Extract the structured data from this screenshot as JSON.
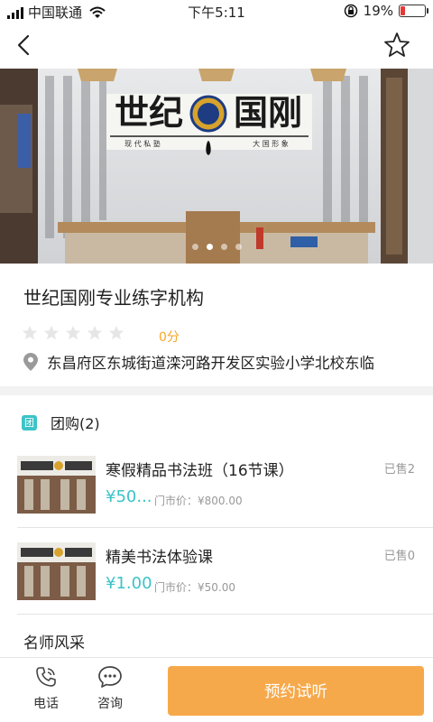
{
  "status_bar": {
    "carrier": "中国联通",
    "time": "下午5:11",
    "battery_percent": "19%",
    "battery_level": 0.19,
    "icons": [
      "signal-icon",
      "wifi-icon",
      "orientation-lock-icon",
      "battery-icon"
    ]
  },
  "nav": {
    "back_icon": "back-arrow-icon",
    "favorite_icon": "star-outline-icon"
  },
  "banner": {
    "sign_left": "世纪",
    "sign_right": "国刚",
    "sign_sub_left": "现 代 私 塾",
    "sign_sub_right": "大 国 形 象",
    "slide_count": 4,
    "active_slide": 2
  },
  "shop": {
    "name": "世纪国刚专业练字机构",
    "stars_filled": 0,
    "stars_total": 5,
    "rating": "0分",
    "address": "东昌府区东城街道滦河路开发区实验小学北校东临"
  },
  "deals": {
    "badge": "团",
    "title": "团购(2)",
    "items": [
      {
        "title": "寒假精品书法班（16节课）",
        "price": "¥50...",
        "orig_label": "门市价：",
        "orig_price": "¥800.00",
        "sold": "已售2"
      },
      {
        "title": "精美书法体验课",
        "price": "¥1.00",
        "orig_label": "门市价：",
        "orig_price": "¥50.00",
        "sold": "已售0"
      }
    ]
  },
  "sections": {
    "teachers": "名师风采"
  },
  "bottom_bar": {
    "phone_label": "电话",
    "consult_label": "咨询",
    "book_label": "预约试听"
  },
  "colors": {
    "accent_teal": "#3cc3c8",
    "rating_orange": "#f5a623",
    "cta_orange": "#f6a94b",
    "battery_red": "#e53935"
  }
}
